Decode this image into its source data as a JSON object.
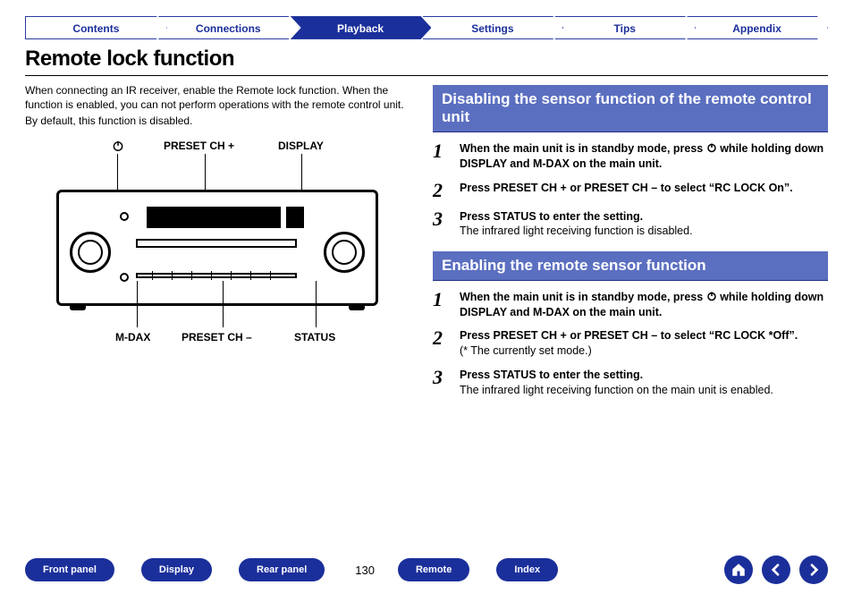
{
  "tabs": [
    "Contents",
    "Connections",
    "Playback",
    "Settings",
    "Tips",
    "Appendix"
  ],
  "active_tab_index": 2,
  "title": "Remote lock function",
  "intro": {
    "p1": "When connecting an IR receiver, enable the Remote lock function. When the function is enabled, you can not perform operations with the remote control unit.",
    "p2": "By default, this function is disabled."
  },
  "diagram_labels": {
    "top1_icon": "power",
    "top2": "PRESET CH +",
    "top3": "DISPLAY",
    "bot1": "M-DAX",
    "bot2": "PRESET CH –",
    "bot3": "STATUS"
  },
  "section1": {
    "heading": "Disabling the sensor function of the remote control unit",
    "steps": [
      {
        "bold_pre": "When the main unit is in standby mode, press ",
        "bold_post": " while holding down DISPLAY and M-DAX on the main unit.",
        "has_power_icon": true
      },
      {
        "bold_pre": "Press PRESET CH + or PRESET CH – to select “RC LOCK On”.",
        "bold_post": "",
        "has_power_icon": false
      },
      {
        "bold_pre": "Press STATUS to enter the setting.",
        "bold_post": "",
        "sub": "The infrared light receiving function is disabled.",
        "has_power_icon": false
      }
    ]
  },
  "section2": {
    "heading": "Enabling the remote sensor function",
    "steps": [
      {
        "bold_pre": "When the main unit is in standby mode, press ",
        "bold_post": " while holding down DISPLAY and M-DAX on the main unit.",
        "has_power_icon": true
      },
      {
        "bold_pre": "Press PRESET CH + or PRESET CH – to select “RC LOCK *Off”.",
        "bold_post": "",
        "sub": "(* The currently set mode.)",
        "has_power_icon": false
      },
      {
        "bold_pre": "Press STATUS to enter the setting.",
        "bold_post": "",
        "sub": "The infrared light receiving function on the main unit is enabled.",
        "has_power_icon": false
      }
    ]
  },
  "footer": {
    "buttons": [
      "Front panel",
      "Display",
      "Rear panel",
      "Remote",
      "Index"
    ],
    "page_number": "130"
  }
}
